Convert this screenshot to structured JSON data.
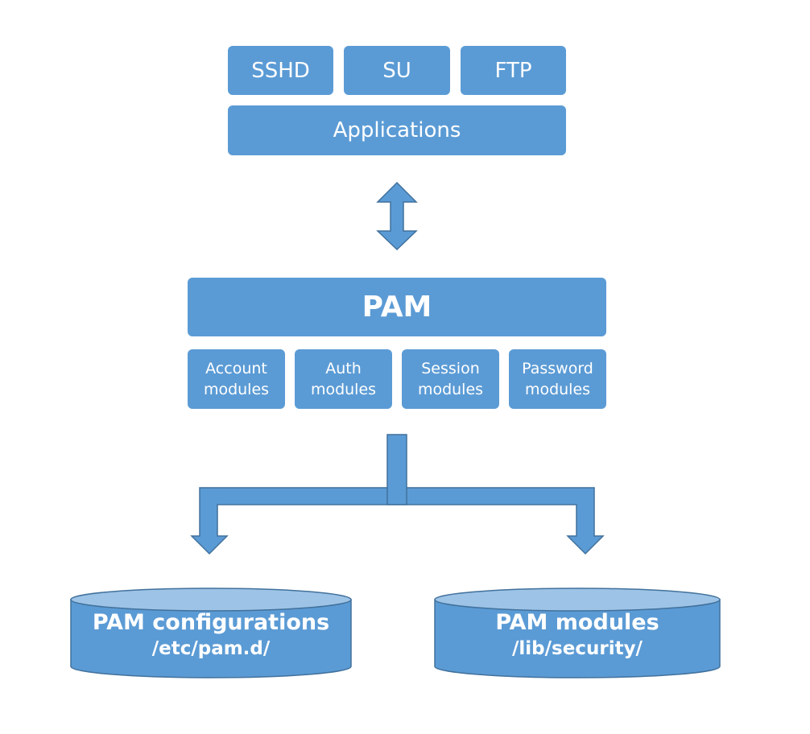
{
  "colors": {
    "box_fill": "#5b9bd5",
    "box_stroke": "#41719c",
    "db_top": "#9dc3e6",
    "text": "#ffffff"
  },
  "applications": {
    "items": [
      "SSHD",
      "SU",
      "FTP"
    ],
    "label": "Applications"
  },
  "pam": {
    "title": "PAM",
    "modules": [
      {
        "line1": "Account",
        "line2": "modules"
      },
      {
        "line1": "Auth",
        "line2": "modules"
      },
      {
        "line1": "Session",
        "line2": "modules"
      },
      {
        "line1": "Password",
        "line2": "modules"
      }
    ]
  },
  "storage": [
    {
      "title": "PAM configurations",
      "path": "/etc/pam.d/"
    },
    {
      "title": "PAM modules",
      "path": "/lib/security/"
    }
  ]
}
